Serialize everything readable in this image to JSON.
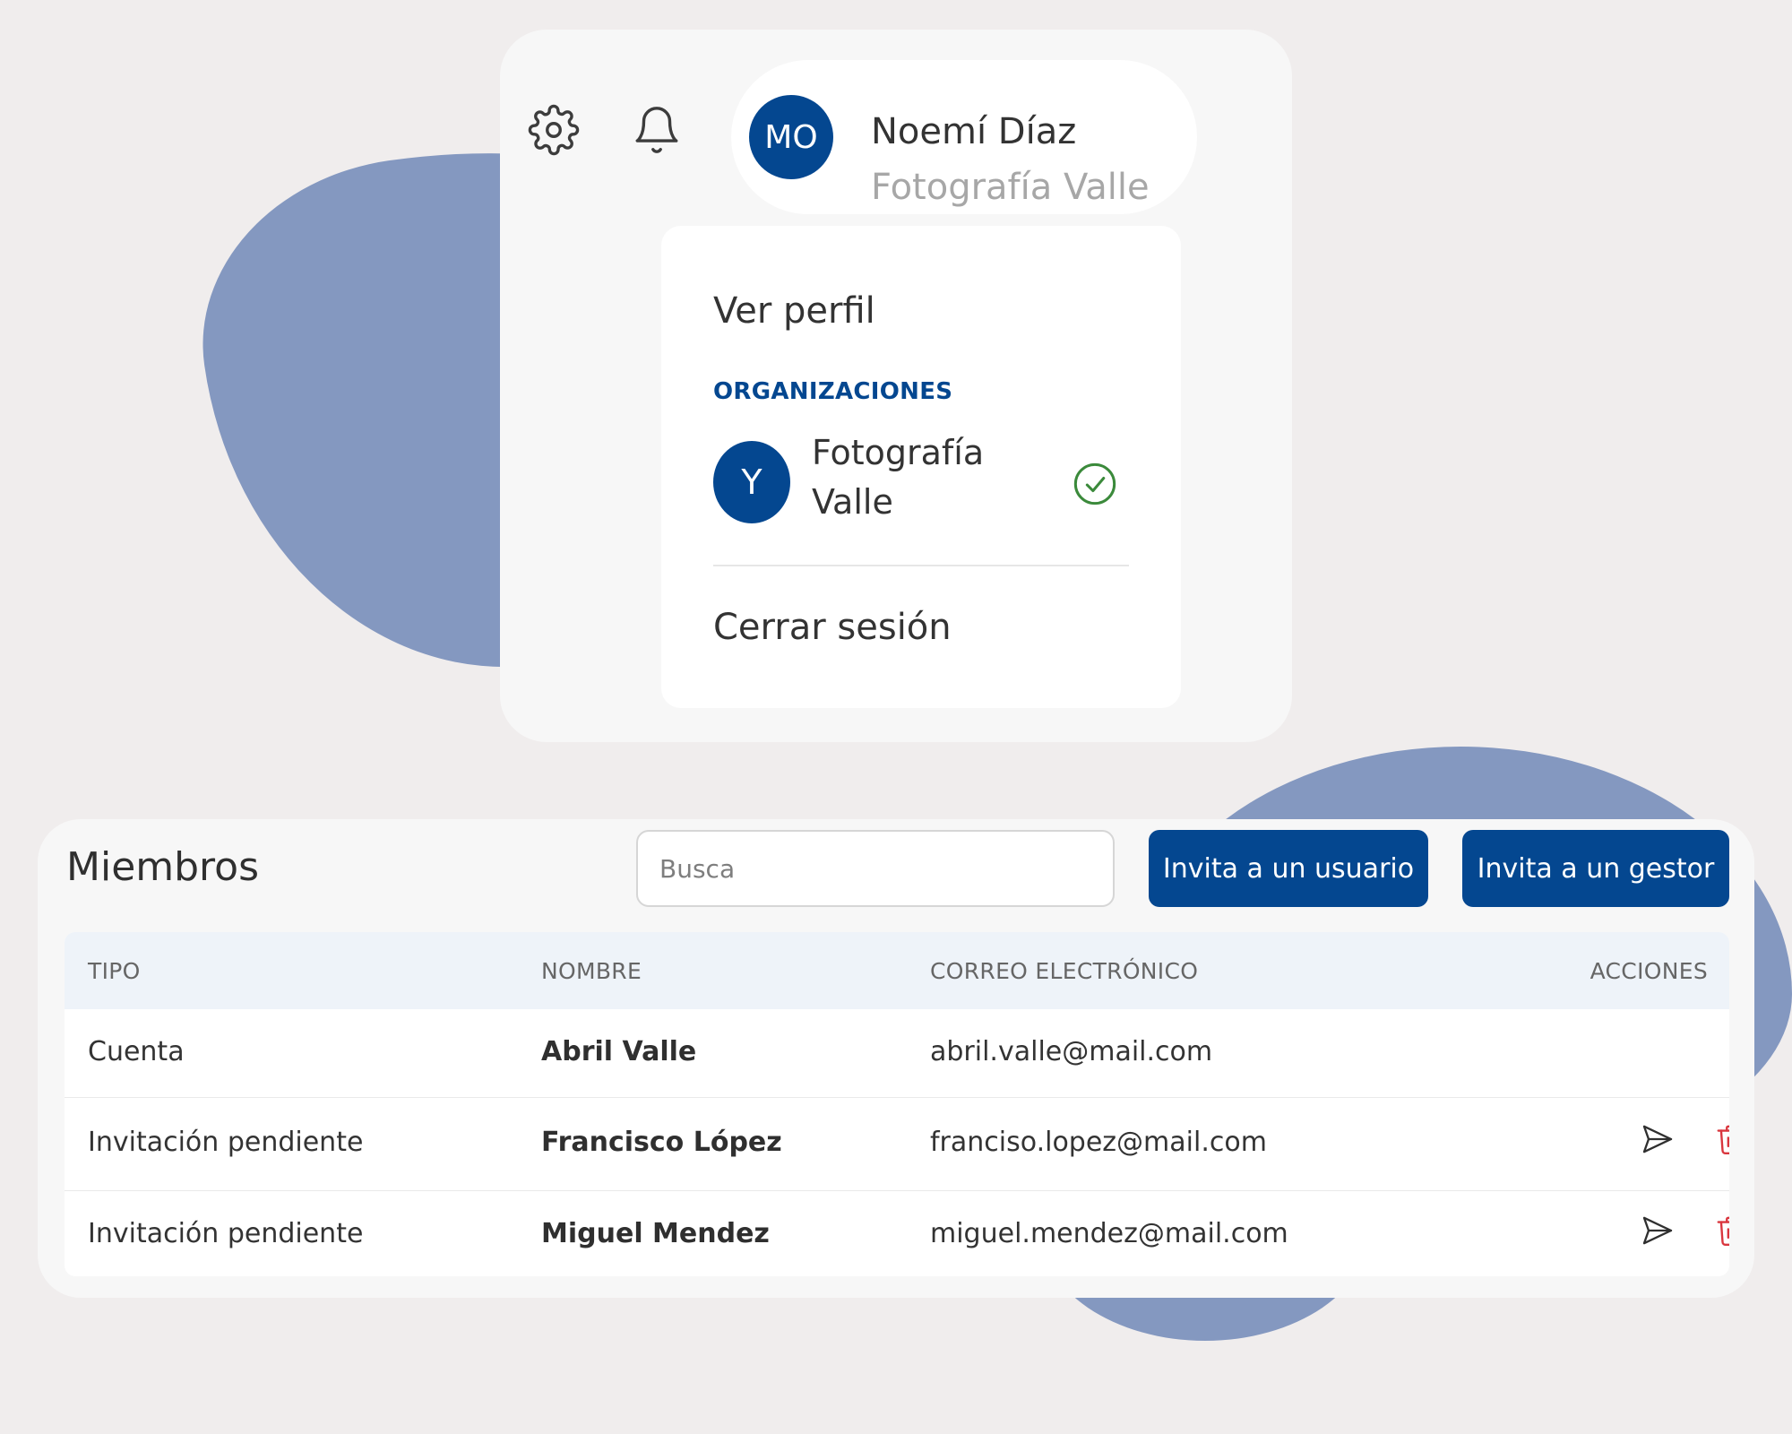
{
  "header": {
    "user_initials": "MO",
    "user_name": "Noemí Díaz",
    "user_org": "Fotografía Valle"
  },
  "icons": {
    "settings": "gear-icon",
    "notifications": "bell-icon",
    "active_org": "check-circle-icon",
    "resend": "send-icon",
    "delete": "trash-icon"
  },
  "dropdown": {
    "view_profile": "Ver perfil",
    "organizations_heading": "ORGANIZACIONES",
    "organization": {
      "initial": "Y",
      "name": "Fotografía Valle"
    },
    "logout": "Cerrar sesión"
  },
  "members": {
    "title": "Miembros",
    "search_placeholder": "Busca",
    "invite_user_label": "Invita a un usuario",
    "invite_manager_label": "Invita a un gestor",
    "columns": {
      "type": "TIPO",
      "name": "NOMBRE",
      "email": "CORREO ELECTRÓNICO",
      "actions": "ACCIONES"
    },
    "rows": [
      {
        "type": "Cuenta",
        "name": "Abril Valle",
        "email": "abril.valle@mail.com"
      },
      {
        "type": "Invitación pendiente",
        "name": "Francisco López",
        "email": "franciso.lopez@mail.com"
      },
      {
        "type": "Invitación pendiente",
        "name": "Miguel Mendez",
        "email": "miguel.mendez@mail.com"
      }
    ]
  },
  "colors": {
    "brand_blue": "#044790",
    "blob_blue": "#8498c0",
    "background": "#f0eded",
    "success_green": "#3b8a3b",
    "danger_red": "#d9363e"
  }
}
